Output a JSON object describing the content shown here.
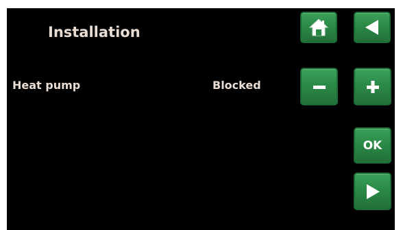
{
  "header": {
    "title": "Installation"
  },
  "setting": {
    "label": "Heat pump",
    "value": "Blocked"
  },
  "buttons": {
    "ok_label": "OK"
  },
  "icons": {
    "home": "home-icon",
    "back": "back-arrow-icon",
    "minus": "minus-icon",
    "plus": "plus-icon",
    "next": "forward-arrow-icon"
  },
  "colors": {
    "background": "#000000",
    "text": "#e9dcd2",
    "button_green": "#2b8a47",
    "button_border": "#1d6b36",
    "icon": "#ffffff"
  }
}
